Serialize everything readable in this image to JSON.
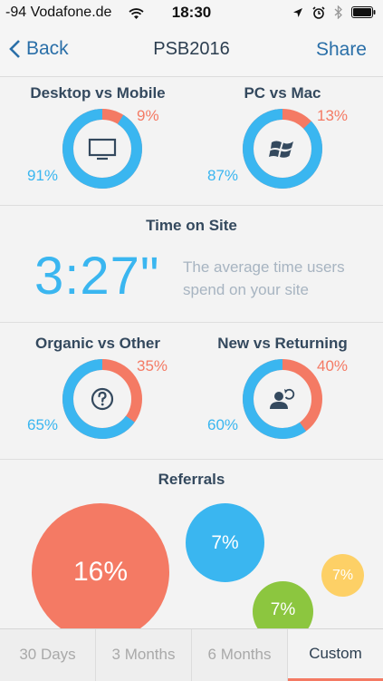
{
  "status_bar": {
    "carrier": "-94 Vodafone.de",
    "time": "18:30"
  },
  "nav": {
    "back_label": "Back",
    "title": "PSB2016",
    "share_label": "Share"
  },
  "colors": {
    "accent_blue": "#3ab6f0",
    "accent_red": "#f47a64",
    "accent_green": "#8cc63f",
    "accent_yellow": "#fdd066"
  },
  "desktop_vs_mobile": {
    "title": "Desktop vs Mobile",
    "primary_pct": "91%",
    "secondary_pct": "9%",
    "primary_fraction": 0.91,
    "icon": "monitor-icon"
  },
  "pc_vs_mac": {
    "title": "PC vs Mac",
    "primary_pct": "87%",
    "secondary_pct": "13%",
    "primary_fraction": 0.87,
    "icon": "windows-logo-icon"
  },
  "time_on_site": {
    "title": "Time on Site",
    "value": "3:27\"",
    "description": "The average time users spend on your site"
  },
  "organic_vs_other": {
    "title": "Organic vs Other",
    "primary_pct": "65%",
    "secondary_pct": "35%",
    "primary_fraction": 0.65,
    "icon": "question-icon"
  },
  "new_vs_returning": {
    "title": "New vs Returning",
    "primary_pct": "60%",
    "secondary_pct": "40%",
    "primary_fraction": 0.6,
    "icon": "returning-user-icon"
  },
  "referrals": {
    "title": "Referrals",
    "bubbles": [
      {
        "label": "16%",
        "color": "#f47a64"
      },
      {
        "label": "7%",
        "color": "#3ab6f0"
      },
      {
        "label": "7%",
        "color": "#8cc63f"
      },
      {
        "label": "7%",
        "color": "#fdd066"
      }
    ]
  },
  "tabs": [
    {
      "label": "30 Days",
      "active": false
    },
    {
      "label": "3 Months",
      "active": false
    },
    {
      "label": "6 Months",
      "active": false
    },
    {
      "label": "Custom",
      "active": true
    }
  ]
}
